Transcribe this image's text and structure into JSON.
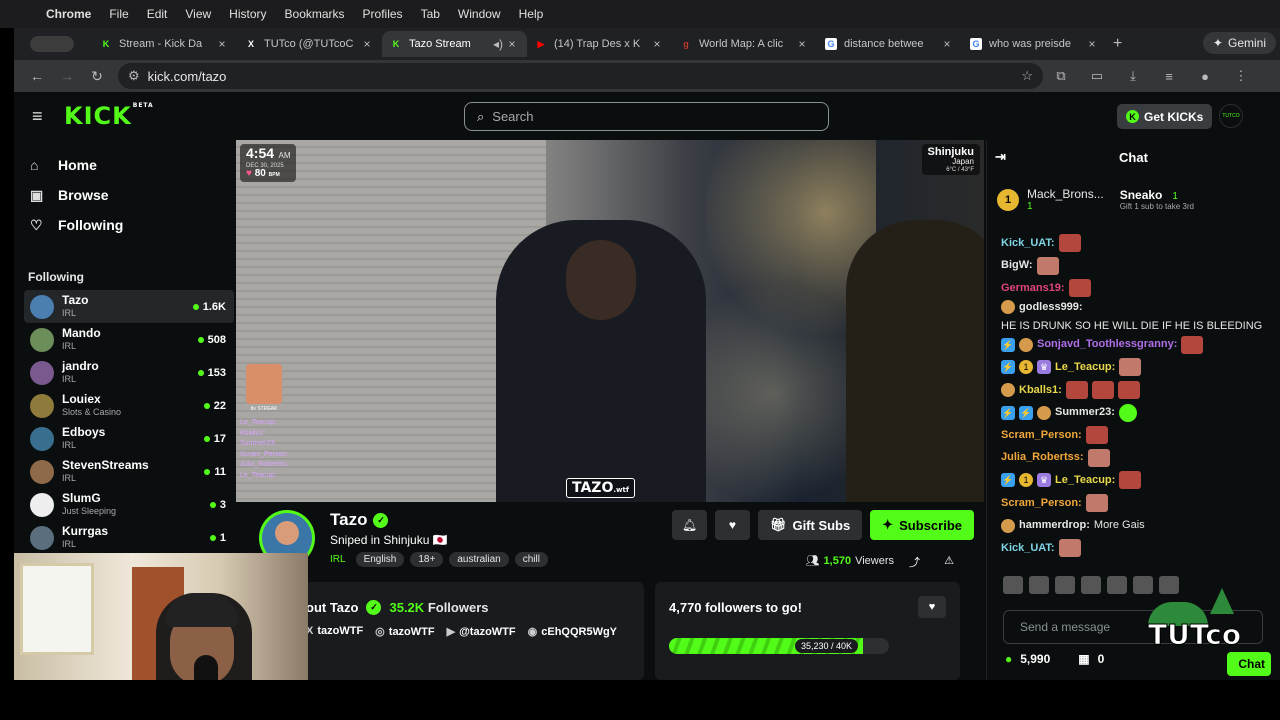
{
  "mac_menu": {
    "app": "Chrome",
    "items": [
      "File",
      "Edit",
      "View",
      "History",
      "Bookmarks",
      "Profiles",
      "Tab",
      "Window",
      "Help"
    ]
  },
  "tabs": [
    {
      "title": "Stream - Kick Da",
      "icon": "kick-icon",
      "color": "#53fc18"
    },
    {
      "title": "TUTco (@TUTcoC",
      "icon": "x-icon",
      "color": "#ffffff"
    },
    {
      "title": "Tazo Stream",
      "icon": "kick-icon",
      "color": "#53fc18"
    },
    {
      "title": "(14) Trap Des x K",
      "icon": "youtube-icon",
      "color": "#ff0000"
    },
    {
      "title": "World Map: A clic",
      "icon": "g-icon",
      "color": "#c0392b"
    },
    {
      "title": "distance betwee",
      "icon": "google-icon",
      "color": "#4285f4"
    },
    {
      "title": "who was preisde",
      "icon": "google-icon",
      "color": "#4285f4"
    }
  ],
  "gemini_label": "Gemini",
  "url": "kick.com/tazo",
  "header": {
    "logo": "KICK",
    "logo_badge": "BETA",
    "search_placeholder": "Search",
    "get_kicks": "Get KICKs",
    "avatar_text": "TUTCO"
  },
  "sidebar": {
    "nav": [
      {
        "label": "Home",
        "icon": "home-icon"
      },
      {
        "label": "Browse",
        "icon": "browse-icon"
      },
      {
        "label": "Following",
        "icon": "heart-icon"
      }
    ],
    "following_title": "Following",
    "following": [
      {
        "name": "Tazo",
        "category": "IRL",
        "viewers": "1.6K",
        "color": "#4a7fb0"
      },
      {
        "name": "Mando",
        "category": "IRL",
        "viewers": "508",
        "color": "#6b8e5a"
      },
      {
        "name": "jandro",
        "category": "IRL",
        "viewers": "153",
        "color": "#7a5a8e"
      },
      {
        "name": "Louiex",
        "category": "Slots & Casino",
        "viewers": "22",
        "color": "#8e7a3a"
      },
      {
        "name": "Edboys",
        "category": "IRL",
        "viewers": "17",
        "color": "#3a6e8e"
      },
      {
        "name": "StevenStreams",
        "category": "IRL",
        "viewers": "11",
        "color": "#8e6a4a"
      },
      {
        "name": "SlumG",
        "category": "Just Sleeping",
        "viewers": "3",
        "color": "#eeeeee"
      },
      {
        "name": "Kurrgas",
        "category": "IRL",
        "viewers": "1",
        "color": "#5a6e7e"
      }
    ]
  },
  "video_overlay": {
    "time": "4:54",
    "time_suffix": "AM",
    "date": "DEC 30, 2025",
    "bpm": "80",
    "bpm_unit": "BPM",
    "location_city": "Shinjuku",
    "location_country": "Japan",
    "weather": "6°C / 43°F",
    "streak": "8x STREAK",
    "overlay_chat": [
      "Le_Teacup:",
      "Kballs1:",
      "Summer23:",
      "Scram_Person:",
      "Julia_Robertss:",
      "Le_Teacup:"
    ],
    "watermark": "TAZO",
    "watermark_suffix": ".wtf"
  },
  "channel": {
    "name": "Tazo",
    "title": "Sniped in Shinjuku 🇯🇵",
    "category": "IRL",
    "tags": [
      "English",
      "18+",
      "australian",
      "chill"
    ],
    "gift_subs": "Gift Subs",
    "subscribe": "Subscribe",
    "viewers_count": "1,570",
    "viewers_label": "Viewers"
  },
  "about": {
    "title": "out Tazo",
    "followers_count": "35.2K",
    "followers_label": "Followers",
    "socials": [
      {
        "icon": "x-icon",
        "label": "tazoWTF"
      },
      {
        "icon": "instagram-icon",
        "label": "tazoWTF"
      },
      {
        "icon": "youtube-icon",
        "label": "@tazoWTF"
      },
      {
        "icon": "discord-icon",
        "label": "cEhQQR5WgY"
      }
    ]
  },
  "goal": {
    "title": "4,770 followers to go!",
    "progress_label": "35,230 / 40K",
    "progress": 0.88
  },
  "chat": {
    "title": "Chat",
    "leaderboard": [
      {
        "rank": "1",
        "name": "Mack_Brons...",
        "count": "1"
      },
      {
        "name": "Sneako",
        "count": "1",
        "sub": "Gift 1 sub to take 3rd"
      }
    ],
    "messages": [
      {
        "user": "Kick_UAT:",
        "color": "#7fd4e6",
        "text": "",
        "emotes": 1,
        "badges": []
      },
      {
        "user": "BigW:",
        "color": "#e6e6e6",
        "text": "",
        "emotes": 1,
        "badges": []
      },
      {
        "user": "Germans19:",
        "color": "#e0457b",
        "text": "",
        "emotes": 1,
        "badges": []
      },
      {
        "user": "godless999:",
        "color": "#e6e6e6",
        "text": "HE IS DRUNK SO HE WILL DIE IF HE IS BLEEDING",
        "emotes": 0,
        "badges": [
          "tan"
        ]
      },
      {
        "user": "Sonjavd_Toothlessgranny:",
        "color": "#b06fe8",
        "text": "",
        "emotes": 1,
        "badges": [
          "blue",
          "tan"
        ]
      },
      {
        "user": "Le_Teacup:",
        "color": "#e8d84a",
        "text": "",
        "emotes": 1,
        "badges": [
          "blue",
          "gold",
          "purple"
        ]
      },
      {
        "user": "Kballs1:",
        "color": "#e8d84a",
        "text": "",
        "emotes": 3,
        "badges": [
          "tan"
        ]
      },
      {
        "user": "Summer23:",
        "color": "#e6e6e6",
        "text": "",
        "emotes": 1,
        "badges": [
          "blue",
          "blue",
          "tan"
        ]
      },
      {
        "user": "Scram_Person:",
        "color": "#f0a63a",
        "text": "",
        "emotes": 1,
        "badges": []
      },
      {
        "user": "Julia_Robertss:",
        "color": "#f0a63a",
        "text": "",
        "emotes": 1,
        "badges": []
      },
      {
        "user": "Le_Teacup:",
        "color": "#e8d84a",
        "text": "",
        "emotes": 1,
        "badges": [
          "blue",
          "gold",
          "purple"
        ]
      },
      {
        "user": "Scram_Person:",
        "color": "#f0a63a",
        "text": "",
        "emotes": 1,
        "badges": []
      },
      {
        "user": "hammerdrop:",
        "color": "#e6e6e6",
        "text": "More Gais",
        "emotes": 0,
        "badges": [
          "tan"
        ]
      },
      {
        "user": "Kick_UAT:",
        "color": "#7fd4e6",
        "text": "",
        "emotes": 1,
        "badges": []
      }
    ],
    "input_placeholder": "Send a message",
    "points": "5,990",
    "gifts": "0",
    "send_label": "Chat"
  },
  "watermark_brand": "TUTco"
}
